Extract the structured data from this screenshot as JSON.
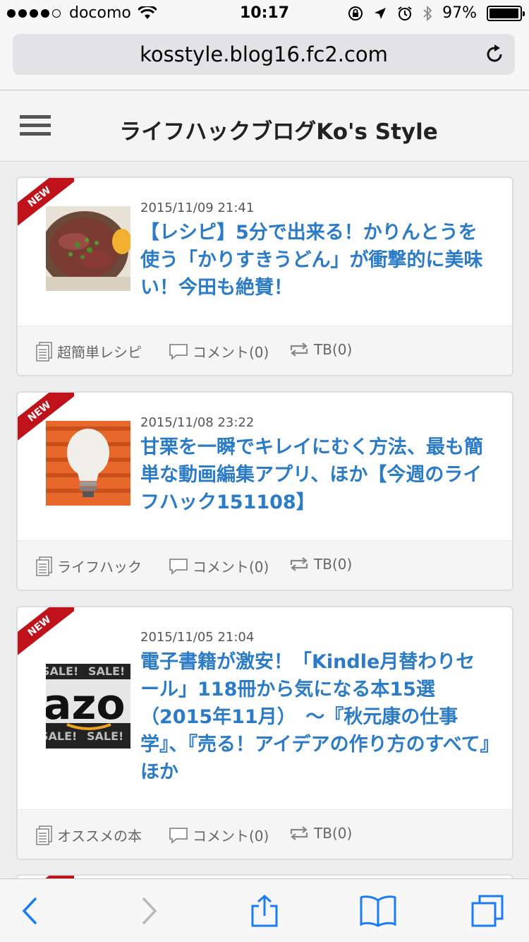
{
  "status_bar": {
    "carrier": "docomo",
    "time": "10:17",
    "battery": "97%",
    "battery_level": 0.97
  },
  "browser": {
    "url": "kosstyle.blog16.fc2.com"
  },
  "blog": {
    "title": "ライフハックブログKo's Style"
  },
  "posts": [
    {
      "badge": "NEW",
      "date": "2015/11/09 21:41",
      "title": "【レシピ】5分で出来る！かりんとうを使う「かりすきうどん」が衝撃的に美味い！今田も絶賛！",
      "category": "超簡単レシピ",
      "comments": "コメント(0)",
      "trackbacks": "TB(0)"
    },
    {
      "badge": "NEW",
      "date": "2015/11/08 23:22",
      "title": "甘栗を一瞬でキレイにむく方法、最も簡単な動画編集アプリ、ほか【今週のライフハック151108】",
      "category": "ライフハック",
      "comments": "コメント(0)",
      "trackbacks": "TB(0)"
    },
    {
      "badge": "NEW",
      "date": "2015/11/05 21:04",
      "title": "電子書籍が激安！「Kindle月替わりセール」118冊から気になる本15選（2015年11月）　～『秋元康の仕事学』、『売る！アイデアの作り方のすべて』ほか",
      "category": "オススメの本",
      "comments": "コメント(0)",
      "trackbacks": "TB(0)"
    }
  ],
  "thumb_text": {
    "amazon": "azo",
    "sale": "SALE!"
  },
  "colors": {
    "link": "#2b7bc7",
    "ribbon": "#c0121a",
    "ios_blue": "#1a7cf5"
  }
}
